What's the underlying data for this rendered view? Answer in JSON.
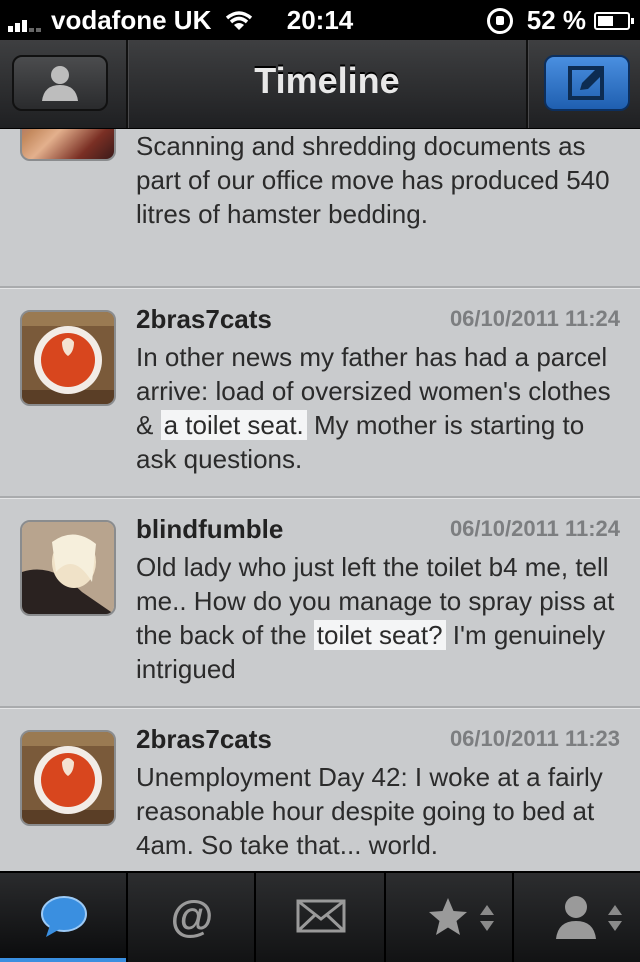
{
  "status": {
    "carrier": "vodafone UK",
    "time": "20:14",
    "battery": "52 %",
    "battery_level": 0.52
  },
  "nav": {
    "title": "Timeline",
    "left_icon": "profile-icon",
    "right_icon": "compose-icon"
  },
  "tweets": [
    {
      "username": "",
      "date": "",
      "text": "Scanning and shredding documents as part of our office move has produced 540 litres of hamster bedding."
    },
    {
      "username": "2bras7cats",
      "date": "06/10/2011 11:24",
      "text_before": "In other news my father has had a parcel arrive: load of oversized women's clothes & ",
      "highlight": "a toilet seat.",
      "text_after": " My mother is starting to ask questions."
    },
    {
      "username": "blindfumble",
      "date": "06/10/2011 11:24",
      "text_before": "Old lady who just left the toilet b4 me, tell me.. How do you manage to spray piss at the back of the ",
      "highlight": "toilet seat?",
      "text_after": " I'm genuinely intrigued"
    },
    {
      "username": "2bras7cats",
      "date": "06/10/2011 11:23",
      "text": "Unemployment Day 42: I woke at a fairly reasonable hour despite going to bed at 4am. So take that... world."
    }
  ],
  "tabs": [
    {
      "name": "timeline-tab",
      "icon": "speech-bubble-icon",
      "active": true
    },
    {
      "name": "mentions-tab",
      "icon": "at-sign-icon",
      "active": false
    },
    {
      "name": "messages-tab",
      "icon": "envelope-icon",
      "active": false
    },
    {
      "name": "favorites-tab",
      "icon": "star-icon",
      "active": false
    },
    {
      "name": "profile-tab",
      "icon": "person-icon",
      "active": false
    }
  ],
  "colors": {
    "accent": "#3a8fe0",
    "background": "#c9cbcd",
    "highlight": "#f4f5f6"
  }
}
